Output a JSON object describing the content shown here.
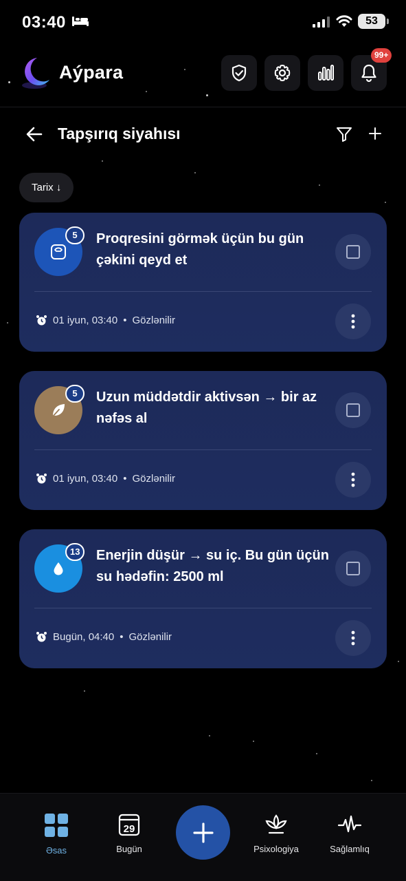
{
  "status_bar": {
    "time": "03:40",
    "battery": "53"
  },
  "app": {
    "name": "Aýpara",
    "notification_badge": "99+"
  },
  "page": {
    "title": "Tapşırıq siyahısı",
    "sort_chip": "Tarix ↓"
  },
  "tasks": [
    {
      "title": "Proqresini görmək üçün bu gün çəkini qeyd et",
      "count": "5",
      "icon": "scale-icon",
      "color": "#1d55b8",
      "time": "01 iyun, 03:40",
      "status": "Gözlənilir"
    },
    {
      "title": "Uzun müddətdir aktivsən → bir az nəfəs al",
      "count": "5",
      "icon": "leaf-icon",
      "color": "#9b7d59",
      "time": "01 iyun, 03:40",
      "status": "Gözlənilir"
    },
    {
      "title": "Enerjin düşür → su iç. Bu gün üçün su hədəfin: 2500 ml",
      "count": "13",
      "icon": "water-drop-icon",
      "color": "#1a8fe0",
      "time": "Bugün, 04:40",
      "status": "Gözlənilir"
    }
  ],
  "meta_separator": "•",
  "nav": {
    "home": "Əsas",
    "today": "Bugün",
    "today_day": "29",
    "psychology": "Psixologiya",
    "health": "Sağlamlıq"
  }
}
